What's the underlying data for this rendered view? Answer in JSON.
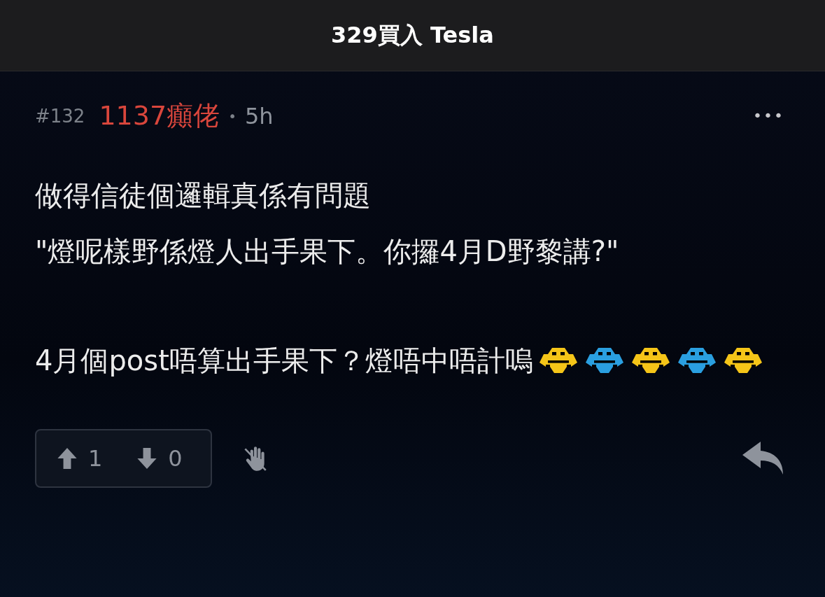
{
  "header": {
    "title": "329買入 Tesla"
  },
  "post": {
    "number": "#132",
    "author": "1137癲佬",
    "separator": "•",
    "time": "5h",
    "more": "•••",
    "lines": [
      "做得信徒個邏輯真係有問題",
      "\"燈呢樣野係燈人出手果下。你攞4月D野黎講?\""
    ],
    "last_line": "4月個post唔算出手果下？燈唔中唔計嗚",
    "emoticons": [
      {
        "kind": "emoticon",
        "color": "#f5c518"
      },
      {
        "kind": "emoticon",
        "color": "#2a9fe0"
      },
      {
        "kind": "emoticon",
        "color": "#f5c518"
      },
      {
        "kind": "emoticon",
        "color": "#2a9fe0"
      },
      {
        "kind": "emoticon",
        "color": "#f5c518"
      }
    ],
    "upvotes": "1",
    "downvotes": "0"
  }
}
